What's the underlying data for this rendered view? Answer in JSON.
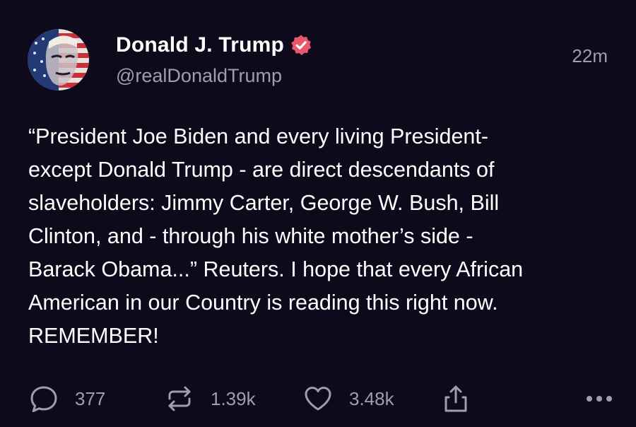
{
  "post": {
    "author": {
      "display_name": "Donald J. Trump",
      "handle": "@realDonaldTrump",
      "verified_icon": "verified-badge-icon",
      "avatar_icon": "profile-avatar"
    },
    "timestamp": "22m",
    "text": "“President Joe Biden and every living President-\nexcept Donald Trump - are direct descendants of\nslaveholders: Jimmy Carter, George W. Bush, Bill\nClinton, and - through his white mother’s side -\nBarack Obama...” Reuters. I hope that every African\nAmerican in our Country is reading this right now.\nREMEMBER!"
  },
  "actions": {
    "replies": {
      "icon": "reply-icon",
      "count": "377"
    },
    "retruths": {
      "icon": "retruth-icon",
      "count": "1.39k"
    },
    "likes": {
      "icon": "heart-icon",
      "count": "3.48k"
    },
    "share": {
      "icon": "share-icon"
    },
    "more": {
      "icon": "more-icon"
    }
  },
  "colors": {
    "background": "#0e0a1c",
    "primary_text": "#ffffff",
    "secondary_text": "#a29bb1",
    "verified_badge": "#e8596b"
  }
}
